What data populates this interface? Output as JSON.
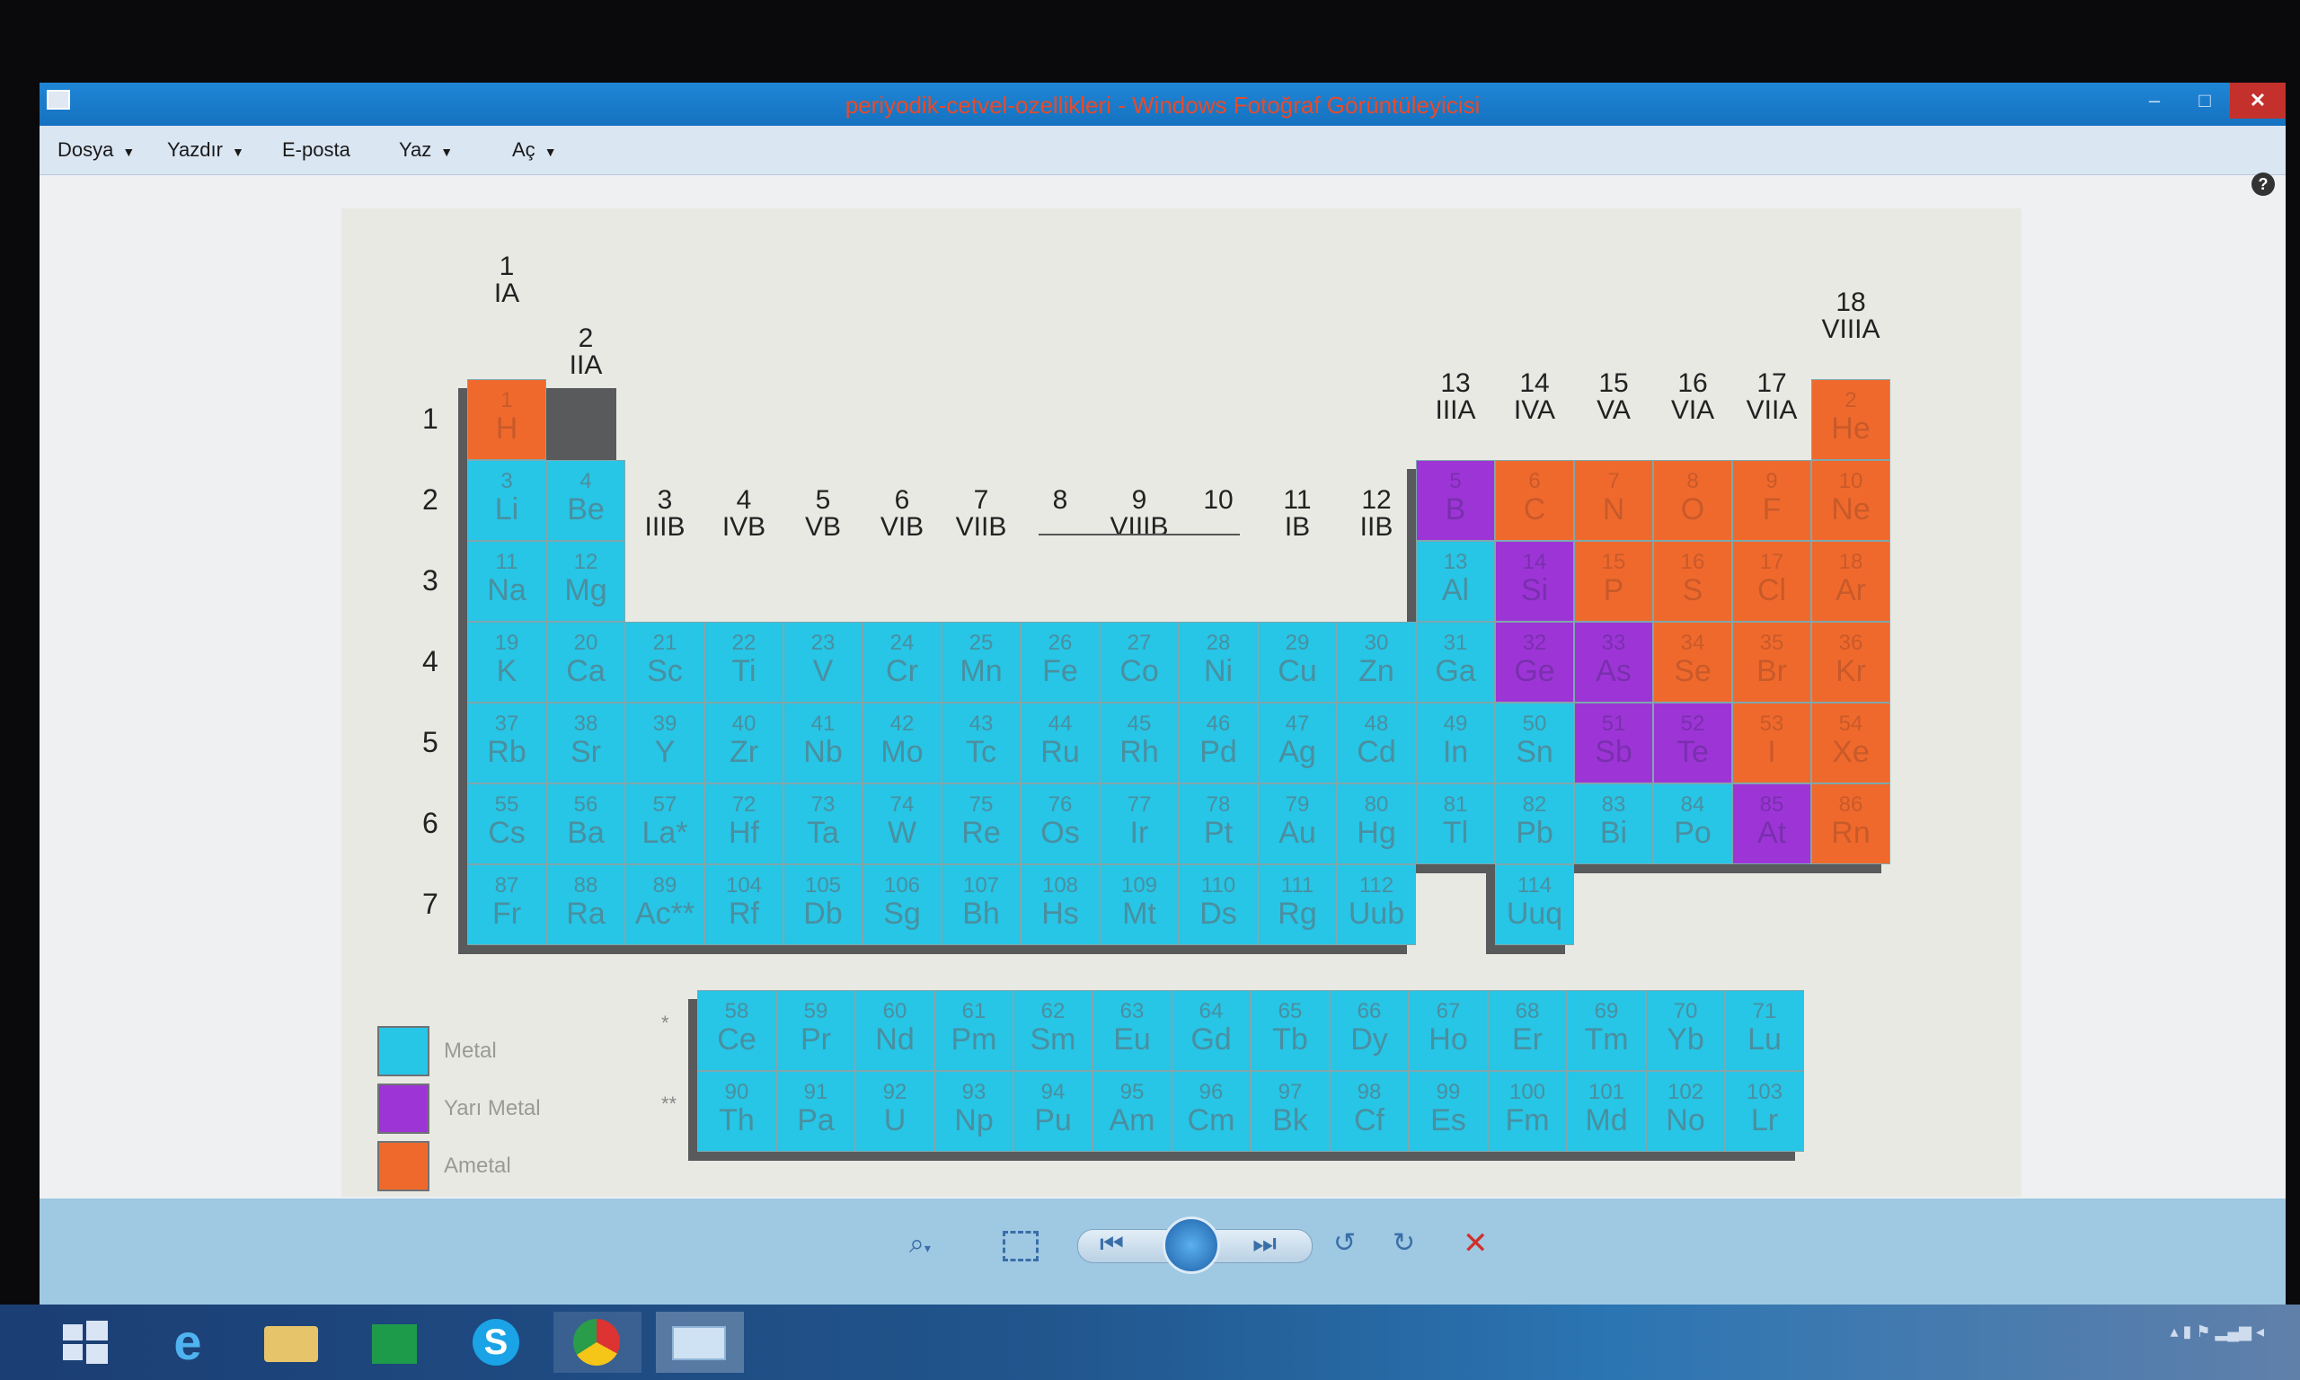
{
  "window": {
    "title": "periyodik-cetvel-ozellikleri - Windows Fotoğraf Görüntüleyicisi"
  },
  "menu": {
    "items": [
      {
        "label": "Dosya"
      },
      {
        "label": "Yazdır"
      },
      {
        "label": "E-posta"
      },
      {
        "label": "Yaz"
      },
      {
        "label": "Aç"
      }
    ]
  },
  "groups": [
    {
      "n": "1",
      "s": "IA"
    },
    {
      "n": "2",
      "s": "IIA"
    },
    {
      "n": "3",
      "s": "IIIB"
    },
    {
      "n": "4",
      "s": "IVB"
    },
    {
      "n": "5",
      "s": "VB"
    },
    {
      "n": "6",
      "s": "VIB"
    },
    {
      "n": "7",
      "s": "VIIB"
    },
    {
      "n": "8",
      "s": ""
    },
    {
      "n": "9",
      "s": "VIIIB"
    },
    {
      "n": "10",
      "s": ""
    },
    {
      "n": "11",
      "s": "IB"
    },
    {
      "n": "12",
      "s": "IIB"
    },
    {
      "n": "13",
      "s": "IIIA"
    },
    {
      "n": "14",
      "s": "IVA"
    },
    {
      "n": "15",
      "s": "VA"
    },
    {
      "n": "16",
      "s": "VIA"
    },
    {
      "n": "17",
      "s": "VIIA"
    },
    {
      "n": "18",
      "s": "VIIIA"
    }
  ],
  "periods": [
    "1",
    "2",
    "3",
    "4",
    "5",
    "6",
    "7"
  ],
  "elements": [
    [
      "1",
      "H",
      1,
      1,
      "nonmetal"
    ],
    [
      "2",
      "He",
      1,
      18,
      "nonmetal"
    ],
    [
      "3",
      "Li",
      2,
      1,
      "metal"
    ],
    [
      "4",
      "Be",
      2,
      2,
      "metal"
    ],
    [
      "5",
      "B",
      2,
      13,
      "semi"
    ],
    [
      "6",
      "C",
      2,
      14,
      "nonmetal"
    ],
    [
      "7",
      "N",
      2,
      15,
      "nonmetal"
    ],
    [
      "8",
      "O",
      2,
      16,
      "nonmetal"
    ],
    [
      "9",
      "F",
      2,
      17,
      "nonmetal"
    ],
    [
      "10",
      "Ne",
      2,
      18,
      "nonmetal"
    ],
    [
      "11",
      "Na",
      3,
      1,
      "metal"
    ],
    [
      "12",
      "Mg",
      3,
      2,
      "metal"
    ],
    [
      "13",
      "Al",
      3,
      13,
      "metal"
    ],
    [
      "14",
      "Si",
      3,
      14,
      "semi"
    ],
    [
      "15",
      "P",
      3,
      15,
      "nonmetal"
    ],
    [
      "16",
      "S",
      3,
      16,
      "nonmetal"
    ],
    [
      "17",
      "Cl",
      3,
      17,
      "nonmetal"
    ],
    [
      "18",
      "Ar",
      3,
      18,
      "nonmetal"
    ],
    [
      "19",
      "K",
      4,
      1,
      "metal"
    ],
    [
      "20",
      "Ca",
      4,
      2,
      "metal"
    ],
    [
      "21",
      "Sc",
      4,
      3,
      "metal"
    ],
    [
      "22",
      "Ti",
      4,
      4,
      "metal"
    ],
    [
      "23",
      "V",
      4,
      5,
      "metal"
    ],
    [
      "24",
      "Cr",
      4,
      6,
      "metal"
    ],
    [
      "25",
      "Mn",
      4,
      7,
      "metal"
    ],
    [
      "26",
      "Fe",
      4,
      8,
      "metal"
    ],
    [
      "27",
      "Co",
      4,
      9,
      "metal"
    ],
    [
      "28",
      "Ni",
      4,
      10,
      "metal"
    ],
    [
      "29",
      "Cu",
      4,
      11,
      "metal"
    ],
    [
      "30",
      "Zn",
      4,
      12,
      "metal"
    ],
    [
      "31",
      "Ga",
      4,
      13,
      "metal"
    ],
    [
      "32",
      "Ge",
      4,
      14,
      "semi"
    ],
    [
      "33",
      "As",
      4,
      15,
      "semi"
    ],
    [
      "34",
      "Se",
      4,
      16,
      "nonmetal"
    ],
    [
      "35",
      "Br",
      4,
      17,
      "nonmetal"
    ],
    [
      "36",
      "Kr",
      4,
      18,
      "nonmetal"
    ],
    [
      "37",
      "Rb",
      5,
      1,
      "metal"
    ],
    [
      "38",
      "Sr",
      5,
      2,
      "metal"
    ],
    [
      "39",
      "Y",
      5,
      3,
      "metal"
    ],
    [
      "40",
      "Zr",
      5,
      4,
      "metal"
    ],
    [
      "41",
      "Nb",
      5,
      5,
      "metal"
    ],
    [
      "42",
      "Mo",
      5,
      6,
      "metal"
    ],
    [
      "43",
      "Tc",
      5,
      7,
      "metal"
    ],
    [
      "44",
      "Ru",
      5,
      8,
      "metal"
    ],
    [
      "45",
      "Rh",
      5,
      9,
      "metal"
    ],
    [
      "46",
      "Pd",
      5,
      10,
      "metal"
    ],
    [
      "47",
      "Ag",
      5,
      11,
      "metal"
    ],
    [
      "48",
      "Cd",
      5,
      12,
      "metal"
    ],
    [
      "49",
      "In",
      5,
      13,
      "metal"
    ],
    [
      "50",
      "Sn",
      5,
      14,
      "metal"
    ],
    [
      "51",
      "Sb",
      5,
      15,
      "semi"
    ],
    [
      "52",
      "Te",
      5,
      16,
      "semi"
    ],
    [
      "53",
      "I",
      5,
      17,
      "nonmetal"
    ],
    [
      "54",
      "Xe",
      5,
      18,
      "nonmetal"
    ],
    [
      "55",
      "Cs",
      6,
      1,
      "metal"
    ],
    [
      "56",
      "Ba",
      6,
      2,
      "metal"
    ],
    [
      "57",
      "La*",
      6,
      3,
      "metal"
    ],
    [
      "72",
      "Hf",
      6,
      4,
      "metal"
    ],
    [
      "73",
      "Ta",
      6,
      5,
      "metal"
    ],
    [
      "74",
      "W",
      6,
      6,
      "metal"
    ],
    [
      "75",
      "Re",
      6,
      7,
      "metal"
    ],
    [
      "76",
      "Os",
      6,
      8,
      "metal"
    ],
    [
      "77",
      "Ir",
      6,
      9,
      "metal"
    ],
    [
      "78",
      "Pt",
      6,
      10,
      "metal"
    ],
    [
      "79",
      "Au",
      6,
      11,
      "metal"
    ],
    [
      "80",
      "Hg",
      6,
      12,
      "metal"
    ],
    [
      "81",
      "Tl",
      6,
      13,
      "metal"
    ],
    [
      "82",
      "Pb",
      6,
      14,
      "metal"
    ],
    [
      "83",
      "Bi",
      6,
      15,
      "metal"
    ],
    [
      "84",
      "Po",
      6,
      16,
      "metal"
    ],
    [
      "85",
      "At",
      6,
      17,
      "semi"
    ],
    [
      "86",
      "Rn",
      6,
      18,
      "nonmetal"
    ],
    [
      "87",
      "Fr",
      7,
      1,
      "metal"
    ],
    [
      "88",
      "Ra",
      7,
      2,
      "metal"
    ],
    [
      "89",
      "Ac**",
      7,
      3,
      "metal"
    ],
    [
      "104",
      "Rf",
      7,
      4,
      "metal"
    ],
    [
      "105",
      "Db",
      7,
      5,
      "metal"
    ],
    [
      "106",
      "Sg",
      7,
      6,
      "metal"
    ],
    [
      "107",
      "Bh",
      7,
      7,
      "metal"
    ],
    [
      "108",
      "Hs",
      7,
      8,
      "metal"
    ],
    [
      "109",
      "Mt",
      7,
      9,
      "metal"
    ],
    [
      "110",
      "Ds",
      7,
      10,
      "metal"
    ],
    [
      "111",
      "Rg",
      7,
      11,
      "metal"
    ],
    [
      "112",
      "Uub",
      7,
      12,
      "metal"
    ],
    [
      "114",
      "Uuq",
      7,
      14,
      "metal"
    ]
  ],
  "lanthanides": {
    "mark": "*",
    "items": [
      [
        "58",
        "Ce"
      ],
      [
        "59",
        "Pr"
      ],
      [
        "60",
        "Nd"
      ],
      [
        "61",
        "Pm"
      ],
      [
        "62",
        "Sm"
      ],
      [
        "63",
        "Eu"
      ],
      [
        "64",
        "Gd"
      ],
      [
        "65",
        "Tb"
      ],
      [
        "66",
        "Dy"
      ],
      [
        "67",
        "Ho"
      ],
      [
        "68",
        "Er"
      ],
      [
        "69",
        "Tm"
      ],
      [
        "70",
        "Yb"
      ],
      [
        "71",
        "Lu"
      ]
    ]
  },
  "actinides": {
    "mark": "**",
    "items": [
      [
        "90",
        "Th"
      ],
      [
        "91",
        "Pa"
      ],
      [
        "92",
        "U"
      ],
      [
        "93",
        "Np"
      ],
      [
        "94",
        "Pu"
      ],
      [
        "95",
        "Am"
      ],
      [
        "96",
        "Cm"
      ],
      [
        "97",
        "Bk"
      ],
      [
        "98",
        "Cf"
      ],
      [
        "99",
        "Es"
      ],
      [
        "100",
        "Fm"
      ],
      [
        "101",
        "Md"
      ],
      [
        "102",
        "No"
      ],
      [
        "103",
        "Lr"
      ]
    ]
  },
  "legend": [
    {
      "label": "Metal",
      "color": "#27c5e6"
    },
    {
      "label": "Yarı Metal",
      "color": "#9d35d6"
    },
    {
      "label": "Ametal",
      "color": "#f0692c"
    }
  ],
  "colors": {
    "metal": "#27c5e6",
    "semi": "#9d35d6",
    "nonmetal": "#f0692c"
  }
}
